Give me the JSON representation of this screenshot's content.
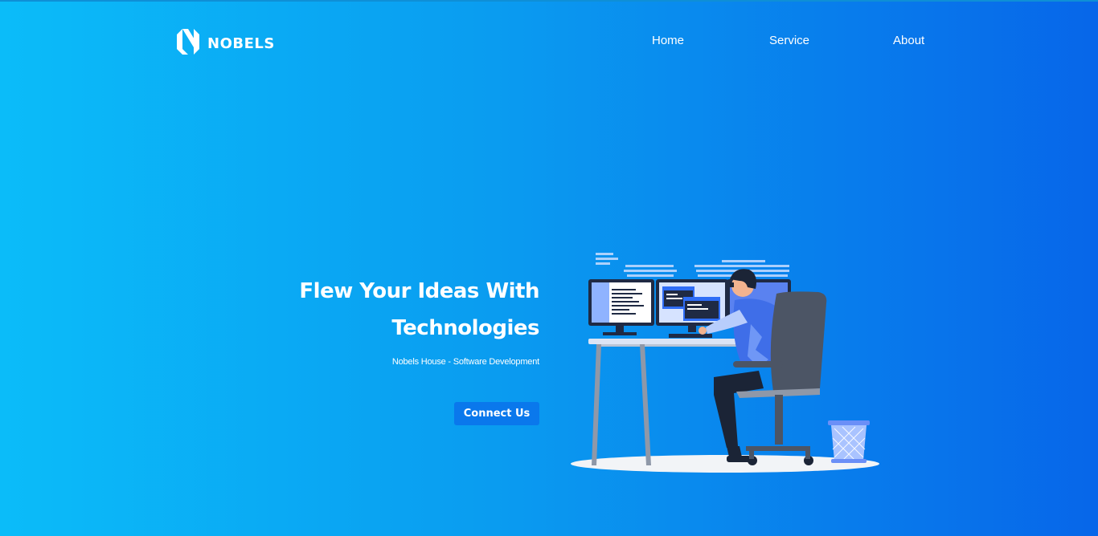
{
  "brand": {
    "name": "NOBELS",
    "logo_icon": "nobels-logo"
  },
  "nav": {
    "items": [
      {
        "label": "Home"
      },
      {
        "label": "Service"
      },
      {
        "label": "About"
      }
    ]
  },
  "hero": {
    "title_line1": "Flew Your Ideas With",
    "title_line2": "Technologies",
    "subtitle": "Nobels House - Software Development",
    "cta_label": "Connect Us",
    "illustration_icon": "developer-at-desk-illustration"
  },
  "colors": {
    "gradient_start": "#0bbcf9",
    "gradient_end": "#0766e9",
    "button": "#0a78ec",
    "text": "#ffffff"
  }
}
